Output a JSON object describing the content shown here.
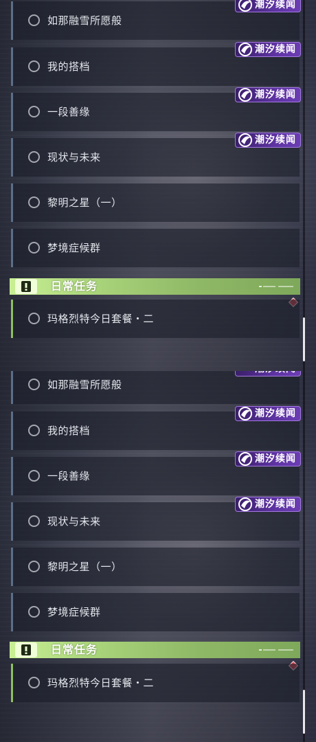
{
  "quests": [
    {
      "name": "如那融雪所愿般",
      "tag": "潮汐续闻"
    },
    {
      "name": "我的搭档",
      "tag": "潮汐续闻"
    },
    {
      "name": "一段善缘",
      "tag": "潮汐续闻"
    },
    {
      "name": "现状与未来",
      "tag": "潮汐续闻"
    },
    {
      "name": "黎明之星（一）",
      "tag": ""
    },
    {
      "name": "梦境症候群",
      "tag": ""
    }
  ],
  "tag_label": "潮汐续闻",
  "daily_section": {
    "title": "日常任务",
    "quest": "玛格烈特今日套餐・二"
  },
  "colors": {
    "tag_purple": "#5e33a2",
    "daily_green": "#a9d47a",
    "quest_accent": "#5d6f88",
    "marker_red": "#d64654"
  },
  "icons": {
    "status": "circle-outline-icon",
    "tag": "wave-emblem-icon",
    "daily": "exclamation-icon",
    "marker": "red-diamond-icon"
  }
}
